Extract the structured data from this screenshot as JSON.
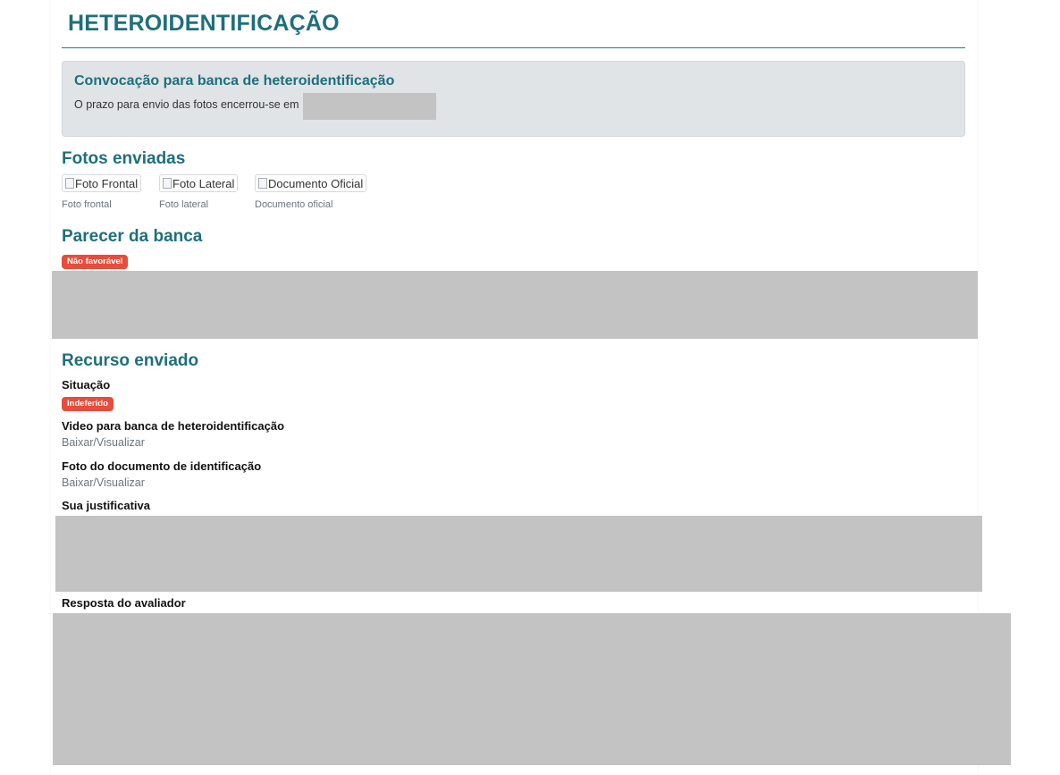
{
  "page": {
    "title": "HETEROIDENTIFICAÇÃO"
  },
  "notice": {
    "title": "Convocação para banca de heteroidentificação",
    "text": "O prazo para envio das fotos encerrou-se em"
  },
  "photos": {
    "section_title": "Fotos enviadas",
    "items": [
      {
        "alt": "Foto Frontal",
        "caption": "Foto frontal"
      },
      {
        "alt": "Foto Lateral",
        "caption": "Foto lateral"
      },
      {
        "alt": "Documento Oficial",
        "caption": "Documento oficial"
      }
    ]
  },
  "board_opinion": {
    "section_title": "Parecer da banca",
    "badge": "Não favorável"
  },
  "appeal": {
    "section_title": "Recurso enviado",
    "status_label": "Situação",
    "status_badge": "Indeferido",
    "video_label": "Video para banca de heteroidentificação",
    "video_link": "Baixar/Visualizar",
    "doc_label": "Foto do documento de identificação",
    "doc_link": "Baixar/Visualizar",
    "justification_label": "Sua justificativa",
    "reviewer_label": "Resposta do avaliador"
  },
  "colors": {
    "accent": "#1e6f7b",
    "danger": "#e74c3c",
    "redaction": "#c3c3c3",
    "notice_bg": "#e0e4e7"
  }
}
